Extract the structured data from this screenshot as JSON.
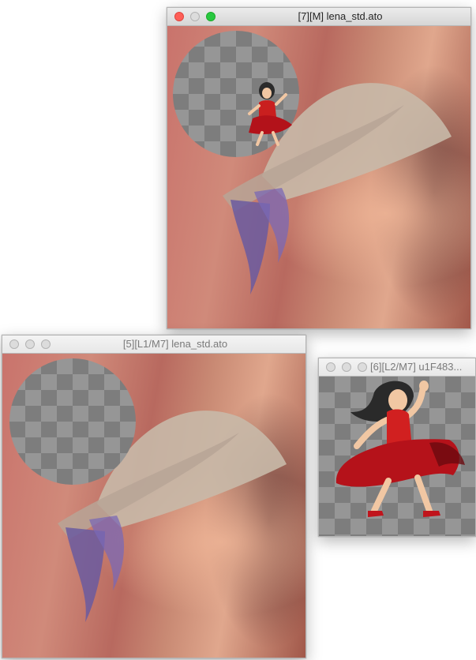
{
  "windows": {
    "main": {
      "title": "[7][M] lena_std.ato",
      "active": true,
      "colors": {
        "close": "#fe5f57",
        "minimize": "#febc2e",
        "zoom": "#28c840"
      }
    },
    "left": {
      "title": "[5][L1/M7] lena_std.ato",
      "active": false
    },
    "right": {
      "title": "[6][L2/M7] u1F483...",
      "active": false
    }
  },
  "icons": {
    "transparency_pattern": "checkerboard",
    "sprite": "dancer-emoji-u1F483"
  }
}
